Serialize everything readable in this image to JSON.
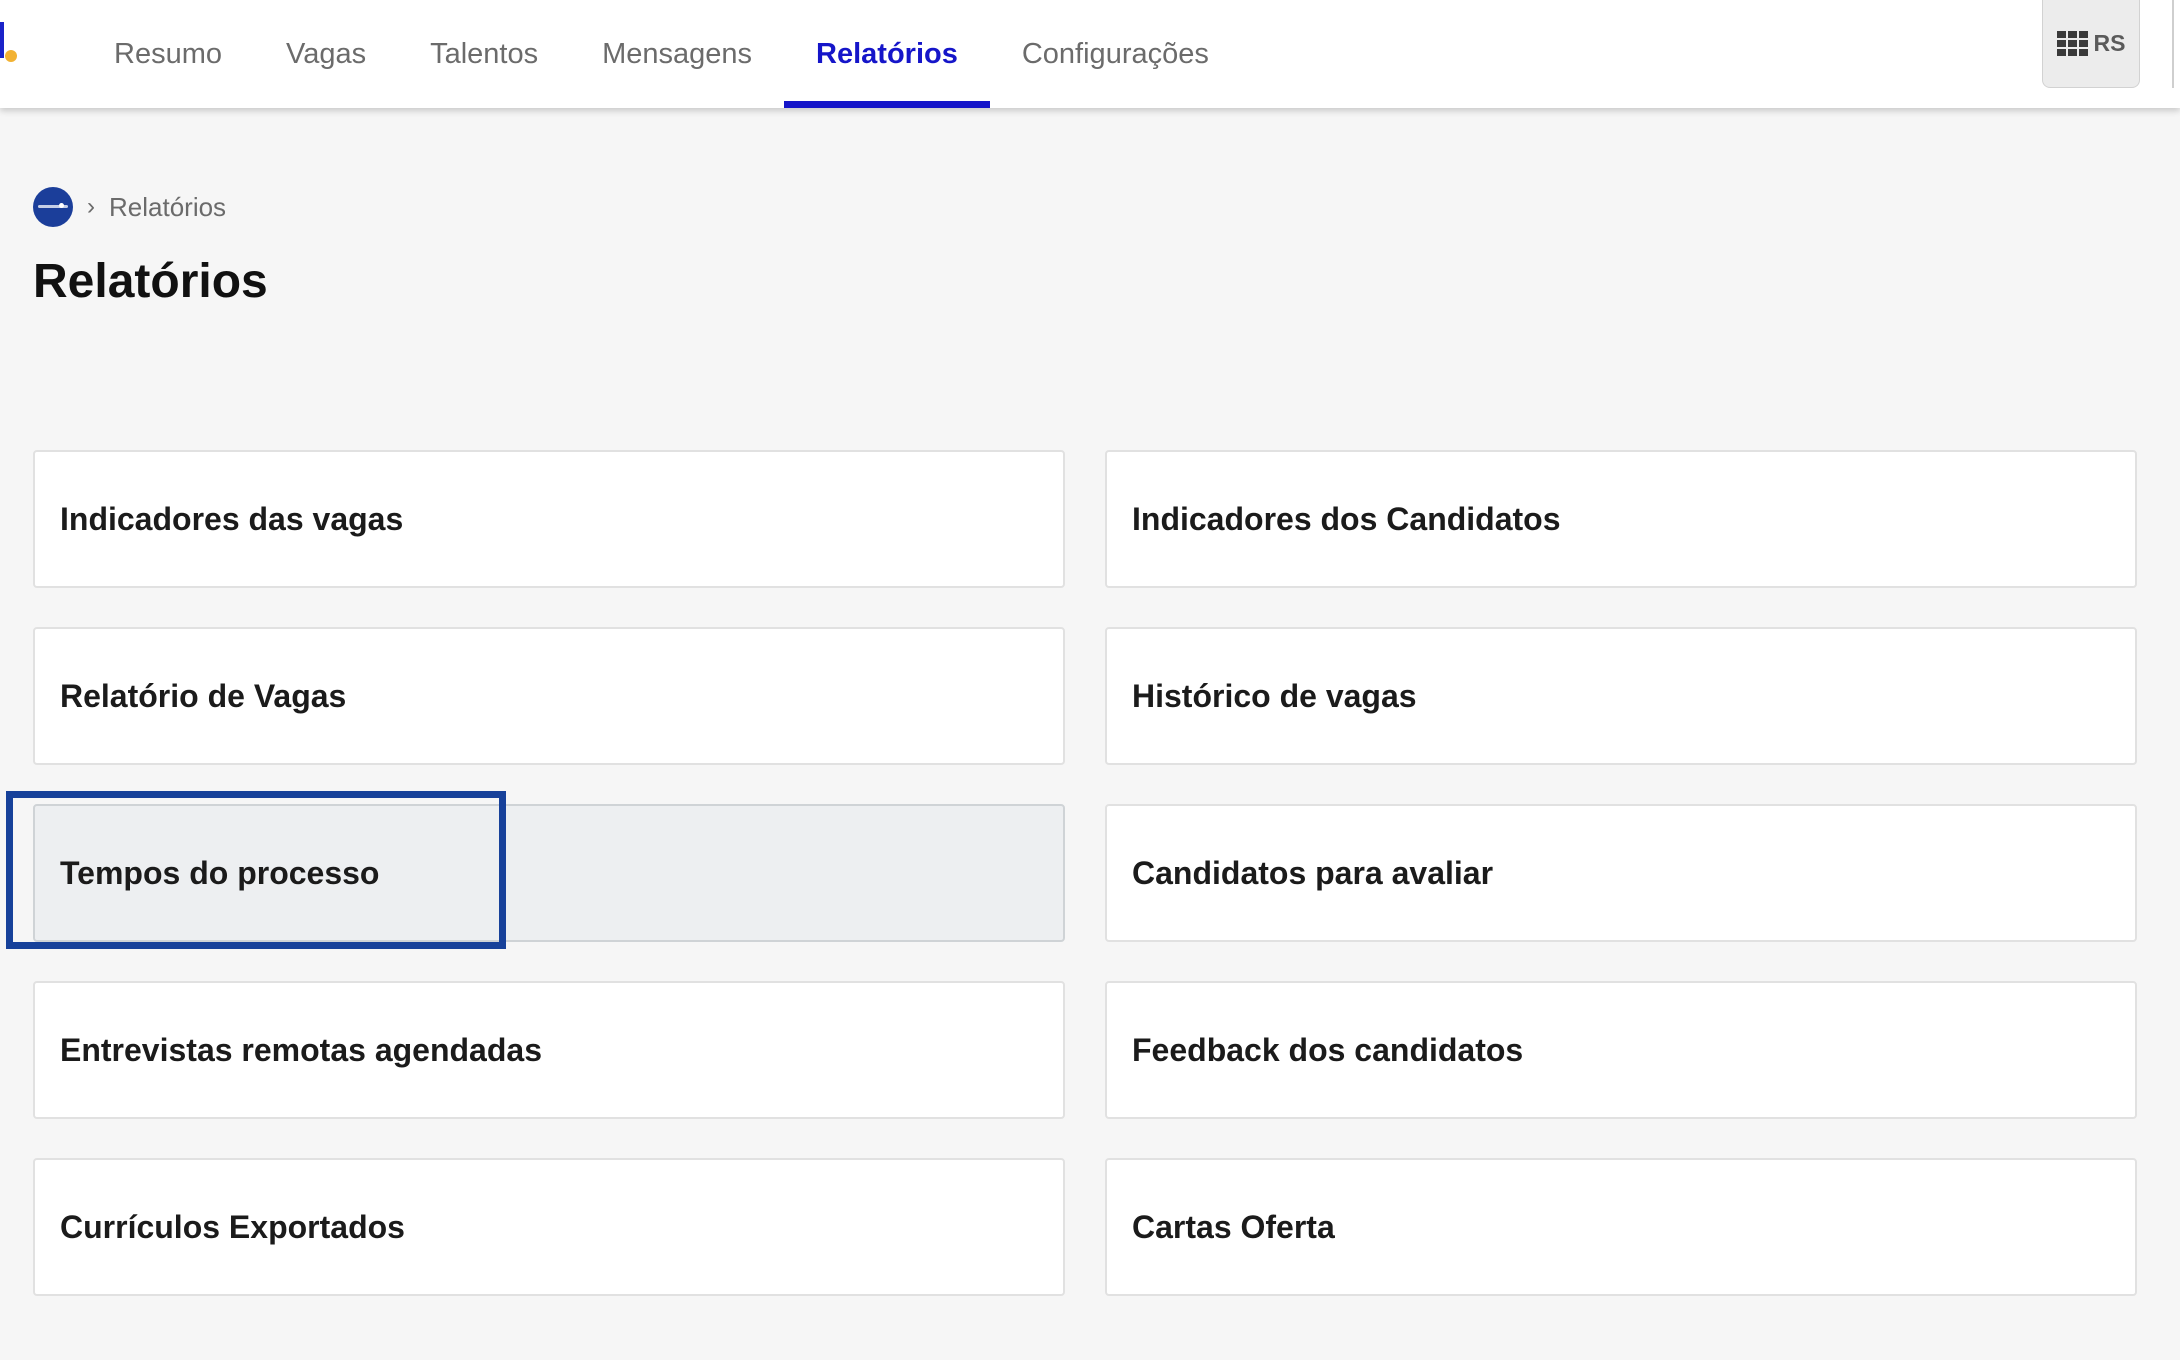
{
  "nav": {
    "tabs": [
      {
        "label": "Resumo"
      },
      {
        "label": "Vagas"
      },
      {
        "label": "Talentos"
      },
      {
        "label": "Mensagens"
      },
      {
        "label": "Relatórios",
        "active": true
      },
      {
        "label": "Configurações"
      }
    ],
    "user_initials": "RS",
    "apps_icon": "grid-icon"
  },
  "breadcrumb": {
    "home_icon": "company-avatar",
    "separator_icon": "chevron-right-icon",
    "current": "Relatórios"
  },
  "page": {
    "title": "Relatórios"
  },
  "reports": [
    {
      "label": "Indicadores das vagas"
    },
    {
      "label": "Indicadores dos Candidatos"
    },
    {
      "label": "Relatório de Vagas"
    },
    {
      "label": "Histórico de vagas"
    },
    {
      "label": "Tempos do processo",
      "highlighted": true
    },
    {
      "label": "Candidatos para avaliar"
    },
    {
      "label": "Entrevistas remotas agendadas"
    },
    {
      "label": "Feedback dos candidatos"
    },
    {
      "label": "Currículos Exportados"
    },
    {
      "label": "Cartas Oferta"
    }
  ],
  "colors": {
    "accent": "#1515c9",
    "highlight": "#17419a",
    "logo_dot": "#f2b233"
  }
}
